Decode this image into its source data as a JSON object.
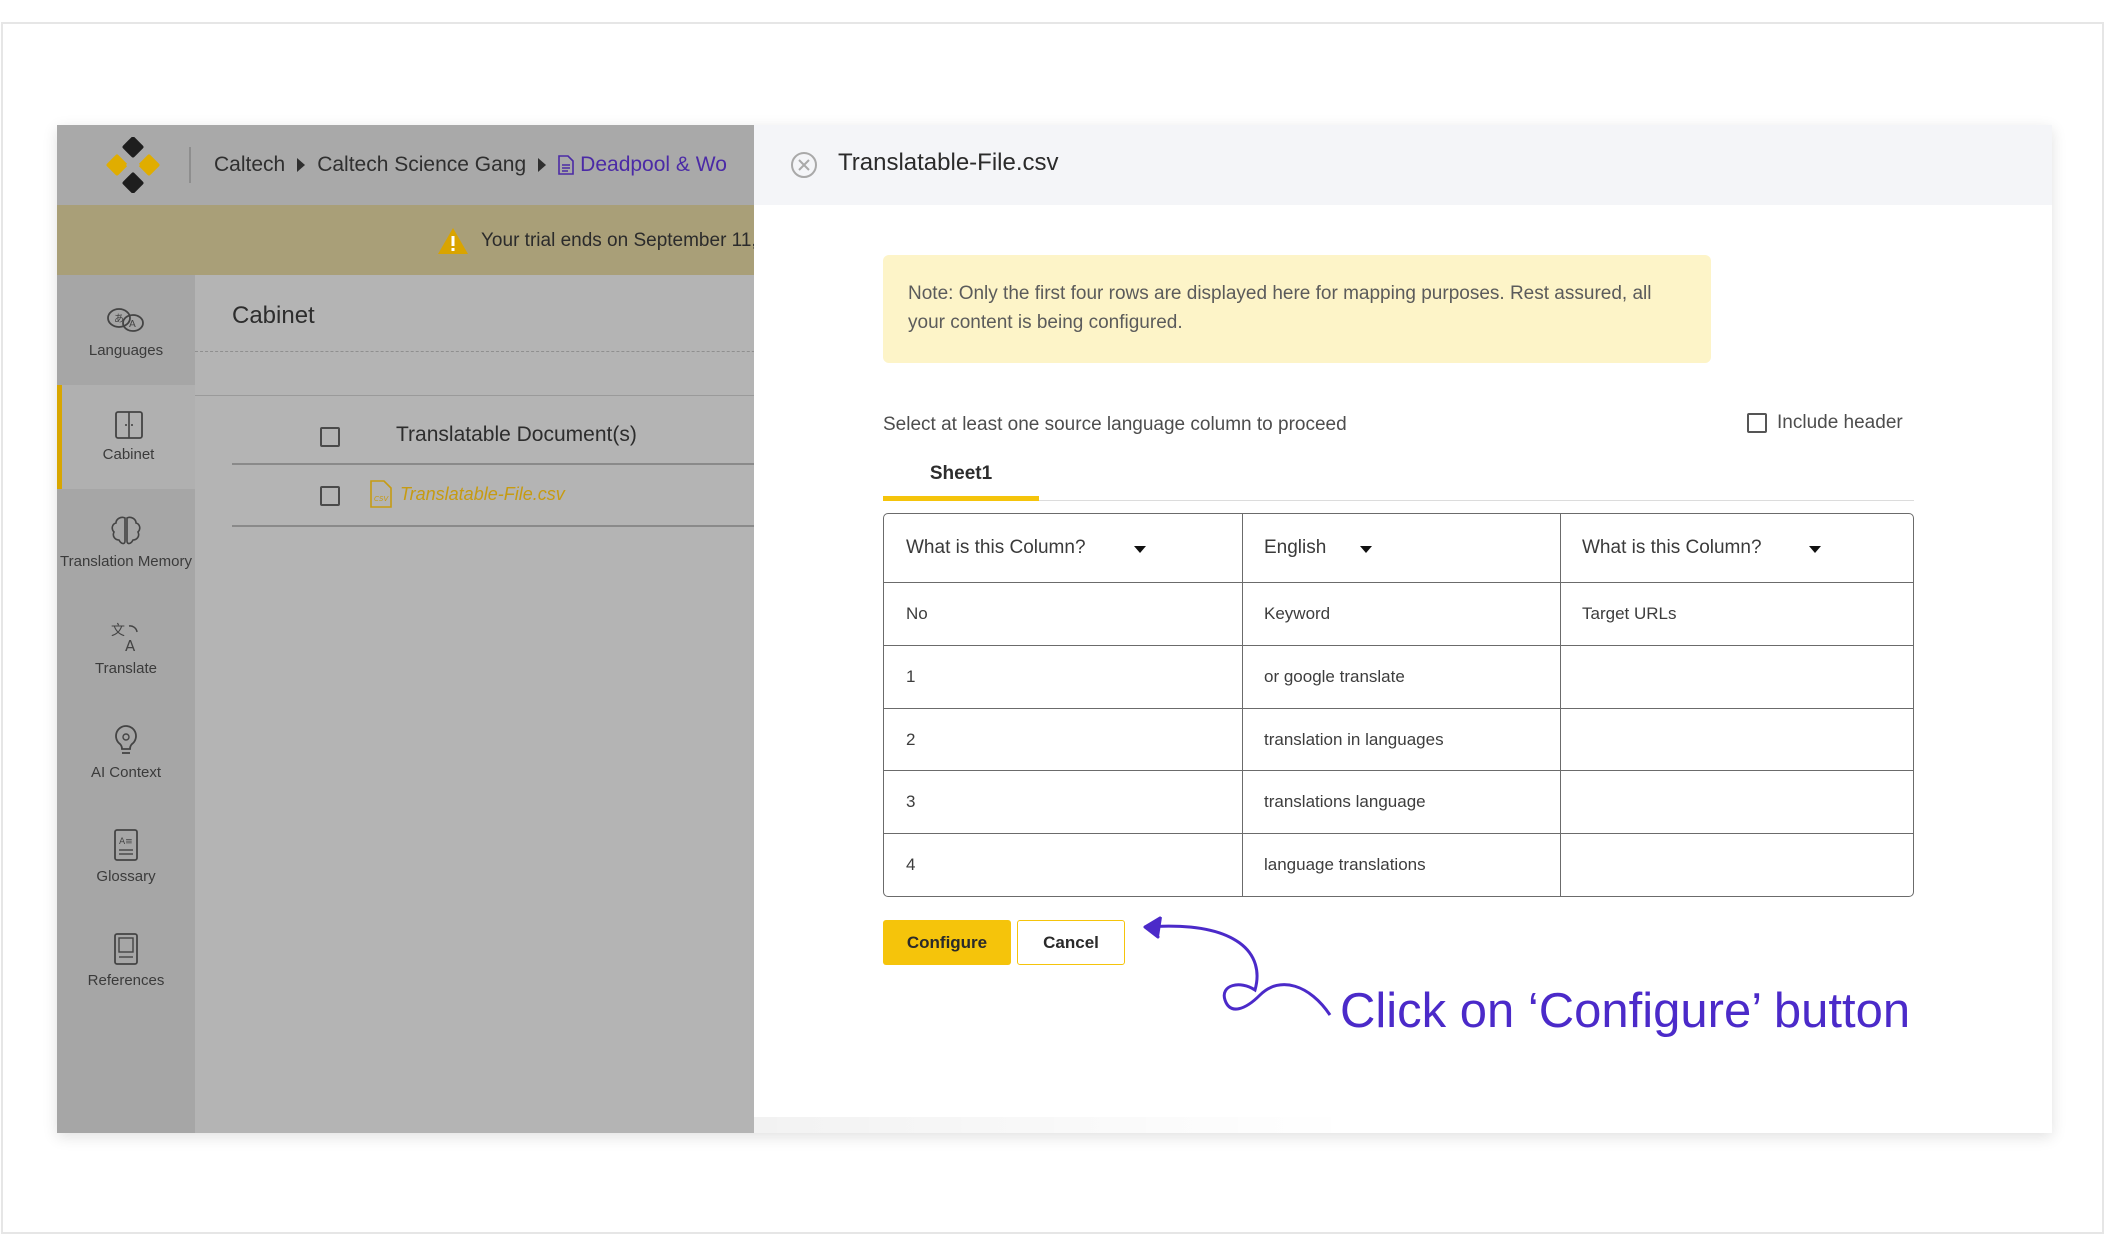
{
  "breadcrumb": {
    "org": "Caltech",
    "team": "Caltech Science Gang",
    "document": "Deadpool & Wo"
  },
  "trial_banner": "Your trial ends on September 11,",
  "sidebar": {
    "items": [
      {
        "label": "Languages",
        "icon": "languages-icon"
      },
      {
        "label": "Cabinet",
        "icon": "cabinet-icon",
        "active": true
      },
      {
        "label": "Translation Memory",
        "icon": "brain-icon"
      },
      {
        "label": "Translate",
        "icon": "translate-icon"
      },
      {
        "label": "AI Context",
        "icon": "lightbulb-icon"
      },
      {
        "label": "Glossary",
        "icon": "glossary-icon"
      },
      {
        "label": "References",
        "icon": "references-icon"
      }
    ]
  },
  "cabinet": {
    "title": "Cabinet",
    "column_header": "Translatable Document(s)",
    "file": "Translatable-File.csv"
  },
  "panel": {
    "title": "Translatable-File.csv",
    "note": "Note: Only the first four rows are displayed here for mapping purposes. Rest assured, all your content is being configured.",
    "select_label": "Select at least one source language column to proceed",
    "include_header": "Include header",
    "tab": "Sheet1",
    "columns": [
      "What is this Column?",
      "English",
      "What is this Column?"
    ],
    "rows": [
      [
        "No",
        "Keyword",
        "Target URLs"
      ],
      [
        "1",
        "or google translate",
        ""
      ],
      [
        "2",
        "translation in languages",
        ""
      ],
      [
        "3",
        "translations language",
        ""
      ],
      [
        "4",
        "language translations",
        ""
      ]
    ],
    "configure": "Configure",
    "cancel": "Cancel"
  },
  "callout": "Click on ‘Configure’ button",
  "colors": {
    "accent": "#f5c40b",
    "callout": "#4b2ac9",
    "note_bg": "#fdf4c8"
  }
}
